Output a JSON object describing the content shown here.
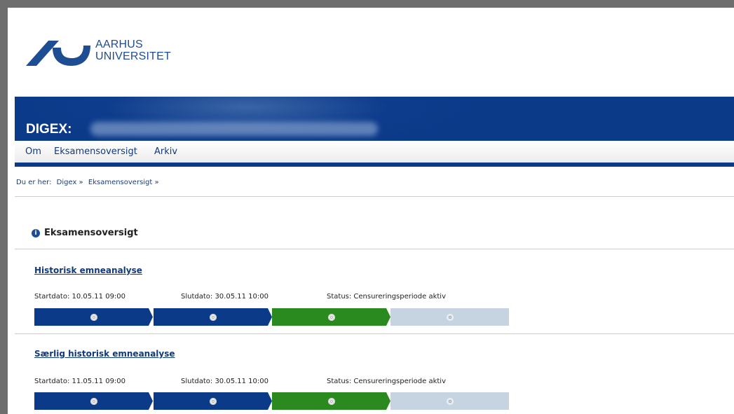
{
  "logo": {
    "line1": "AARHUS",
    "line2": "UNIVERSITET"
  },
  "banner": {
    "title": "DIGEX:"
  },
  "nav": {
    "items": [
      "Om",
      "Eksamensoversigt",
      "Arkiv"
    ]
  },
  "breadcrumb": {
    "prefix": "Du er her:",
    "items": [
      "Digex »",
      "Eksamensoversigt »"
    ]
  },
  "section": {
    "title": "Eksamensoversigt",
    "icon": "info-icon"
  },
  "exams": [
    {
      "title": "Historisk emneanalyse",
      "start": "Startdato: 10.05.11 09:00",
      "end": "Slutdato: 30.05.11 10:00",
      "status": "Status: Censureringsperiode aktiv",
      "progress": [
        "completed",
        "completed",
        "active",
        "pending"
      ]
    },
    {
      "title": "Særlig historisk emneanalyse",
      "start": "Startdato: 11.05.11 09:00",
      "end": "Slutdato: 30.05.11 10:00",
      "status": "Status: Censureringsperiode aktiv",
      "progress": [
        "completed",
        "completed",
        "active",
        "pending"
      ]
    }
  ],
  "colors": {
    "brand": "#0b3a89",
    "active": "#2b8a1f",
    "pending": "#c6d3e1"
  }
}
